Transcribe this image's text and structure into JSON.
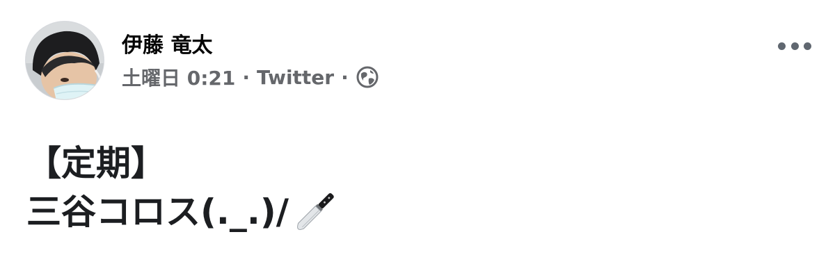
{
  "post": {
    "author_name": "伊藤 竜太",
    "timestamp": "土曜日 0:21",
    "source": "Twitter",
    "separator": "·",
    "privacy_icon": "globe-icon",
    "more_icon": "more-options-icon",
    "body_lines": [
      "【定期】",
      "三谷コロス(._.)/"
    ],
    "emoji_icon": "knife-icon"
  },
  "colors": {
    "text_primary": "#050505",
    "text_secondary": "#65676b",
    "icon_gray": "#606770"
  }
}
